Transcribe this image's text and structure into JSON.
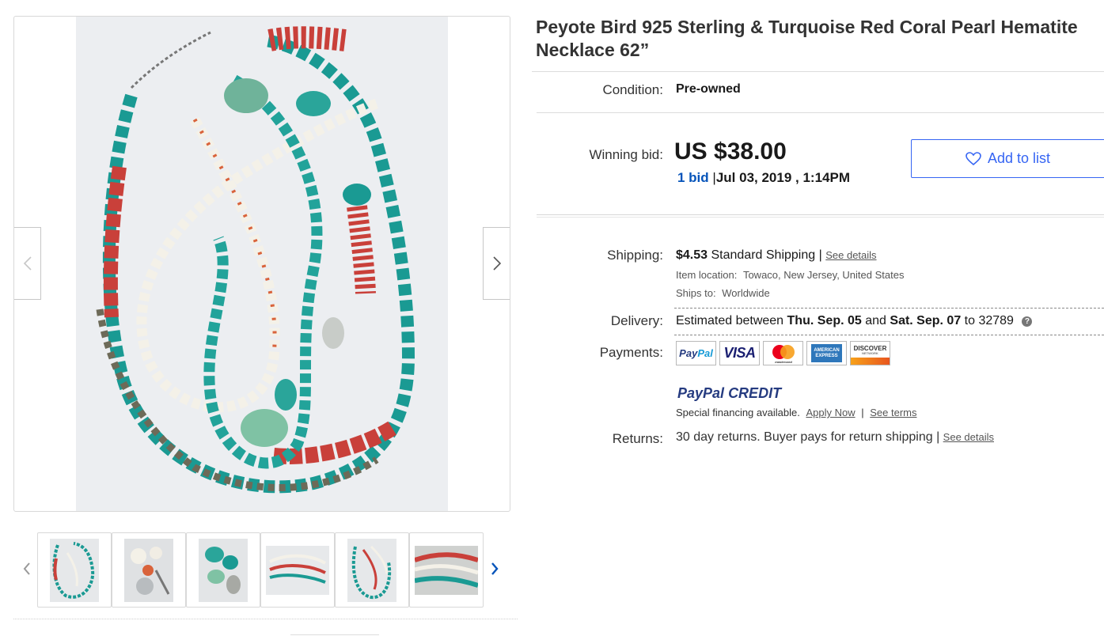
{
  "listing": {
    "title": "Peyote Bird 925 Sterling & Turquoise Red Coral Pearl Hematite Necklace 62”"
  },
  "condition": {
    "label": "Condition:",
    "value": "Pre-owned"
  },
  "bid": {
    "label": "Winning bid:",
    "price": "US $38.00",
    "count_link": "1 bid",
    "separator": "|",
    "date": "Jul 03, 2019 , 1:14PM"
  },
  "actions": {
    "add_to_list": "Add to list"
  },
  "shipping": {
    "label": "Shipping:",
    "cost": "$4.53",
    "method": "Standard Shipping |",
    "details_link": "See details",
    "location_label": "Item location:",
    "location_value": "Towaco, New Jersey, United States",
    "ships_to_label": "Ships to:",
    "ships_to_value": "Worldwide"
  },
  "delivery": {
    "label": "Delivery:",
    "prefix": "Estimated between",
    "start": "Thu. Sep. 05",
    "and": "and",
    "end": "Sat. Sep. 07",
    "to": "to 32789",
    "help": "?"
  },
  "payments": {
    "label": "Payments:",
    "methods": {
      "paypal_a": "Pay",
      "paypal_b": "Pal",
      "visa": "VISA",
      "mastercard_text": "mastercard",
      "amex_text": "AMERICAN EXPRESS",
      "discover_text": "DISCOVER",
      "discover_sub": "NETWORK"
    },
    "paypal_credit_a": "PayPal",
    "paypal_credit_b": "CREDIT",
    "special_text": "Special financing available.",
    "apply_link": "Apply Now",
    "sep": "|",
    "terms_link": "See terms"
  },
  "returns": {
    "label": "Returns:",
    "value": "30 day returns. Buyer pays for return shipping |",
    "details_link": "See details"
  },
  "colors": {
    "accent_blue": "#3665f3",
    "link_blue": "#0654ba",
    "turquoise": "#1a9a93",
    "coral": "#c9403a"
  }
}
